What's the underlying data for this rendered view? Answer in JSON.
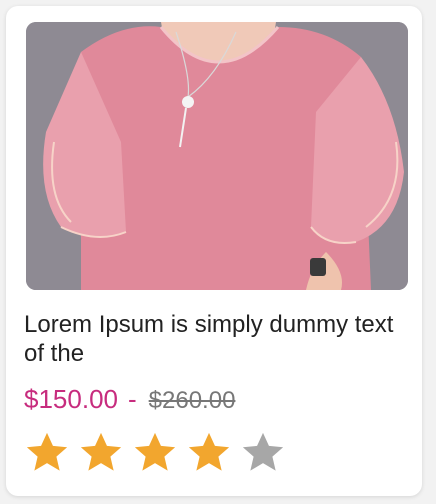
{
  "product": {
    "title": "Lorem Ipsum is simply  dummy text of the",
    "price": "$150.00",
    "separator": "-",
    "original_price": "$260.00",
    "image_icon": "pink-ruffle-blouse-photo",
    "rating": {
      "value": 4,
      "max": 5,
      "filled_color": "#f2a62e",
      "empty_color": "#a7a7a7"
    }
  },
  "colors": {
    "price": "#c72c7e",
    "old_price": "#777777",
    "title": "#222222"
  }
}
